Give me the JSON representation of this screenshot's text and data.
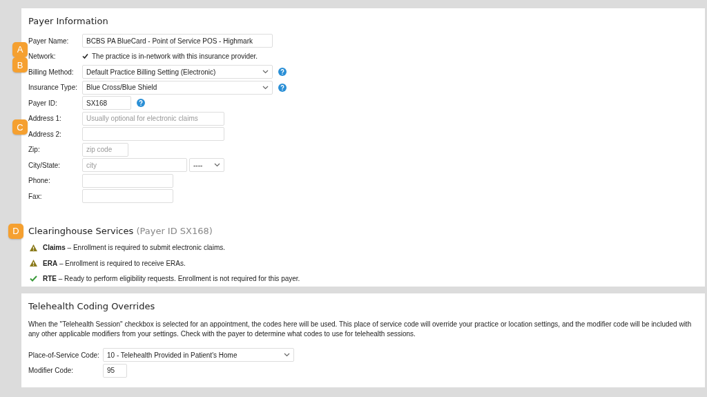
{
  "payer_info": {
    "title": "Payer Information",
    "fields": [
      {
        "label": "Payer Name:",
        "kind": "text",
        "value": "BCBS PA BlueCard - Point of Service POS - Highmark",
        "help": false
      },
      {
        "label": "Network:",
        "kind": "checkbox",
        "text": "The practice is in-network with this insurance provider.",
        "checked": true,
        "badge": "A",
        "help": false
      },
      {
        "label": "Billing Method:",
        "kind": "select",
        "value": "Default Practice Billing Setting (Electronic)",
        "help": true,
        "badge": "B"
      },
      {
        "label": "Insurance Type:",
        "kind": "select",
        "value": "Blue Cross/Blue Shield",
        "help": true
      },
      {
        "label": "Payer ID:",
        "kind": "text",
        "value": "SX168",
        "help": true
      },
      {
        "label": "Address 1:",
        "kind": "text",
        "placeholder": "Usually optional for electronic claims",
        "help": false
      },
      {
        "label": "Address 2:",
        "kind": "text",
        "badge": "C",
        "help": false
      },
      {
        "label": "Zip:",
        "kind": "text",
        "placeholder": "zip code",
        "help": false
      },
      {
        "label": "City/State:",
        "kind": "city_state",
        "placeholder": "city",
        "state": "----",
        "help": false
      },
      {
        "label": "Phone:",
        "kind": "text",
        "help": false
      },
      {
        "label": "Fax:",
        "kind": "text",
        "help": false
      }
    ]
  },
  "clearinghouse": {
    "badge": "D",
    "title": "Clearinghouse Services",
    "subtitle": "(Payer ID SX168)",
    "items": [
      {
        "kind": "warning",
        "text": "**Claims** – Enrollment is required to submit electronic claims."
      },
      {
        "kind": "warning",
        "text": "**ERA** – Enrollment is required to receive ERAs."
      },
      {
        "kind": "ok",
        "text": "**RTE** – Ready to perform eligibility requests. Enrollment is not required for this payer."
      }
    ]
  },
  "telehealth": {
    "title": "Telehealth Coding Overrides",
    "description": "When the \"Telehealth Session\" checkbox is selected for an appointment, the codes here will be used. This place of service code will override your practice or location settings, and the modifier code will be included with any other applicable modifiers from your settings. Check with the payer to determine what codes to use for telehealth sessions.",
    "fields": [
      {
        "label": "Place-of-Service Code:",
        "kind": "select",
        "value": "10 - Telehealth Provided in Patient's Home"
      },
      {
        "label": "Modifier Code:",
        "kind": "text",
        "value": "95"
      }
    ]
  }
}
